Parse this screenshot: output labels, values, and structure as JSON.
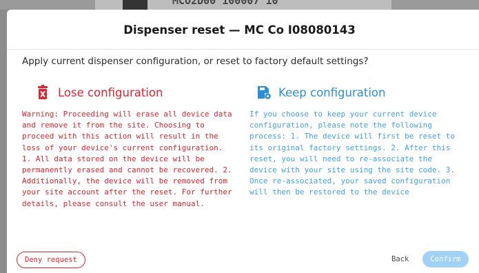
{
  "background": {
    "partial_text": "MCO2D00 100007 10"
  },
  "dialog": {
    "title": "Dispenser reset — MC Co I08080143",
    "question": "Apply current dispenser configuration, or reset to factory default settings?",
    "lose": {
      "icon": "trash-icon",
      "title": "Lose configuration",
      "body": "Warning: Proceeding will erase all device data and remove it from the site. Choosing to proceed with this action will result in the loss of your device's current configuration. 1. All data stored on the device will be permanently erased and cannot be recovered. 2. Additionally, the device will be removed from your site account after the reset. For further details, please consult the user manual.",
      "color": "#e0232f"
    },
    "keep": {
      "icon": "save-settings-icon",
      "title": "Keep configuration",
      "body": "If you choose to keep your current device configuration, please note the following process: 1. The device will first be reset to its original factory settings. 2. After this reset, you will need to re-associate the device with your site using the site code. 3. Once re-associated, your saved configuration will then be restored to the device",
      "color": "#2b8fd8"
    },
    "footer": {
      "deny_label": "Deny request",
      "back_label": "Back",
      "confirm_label": "Confirm"
    }
  }
}
